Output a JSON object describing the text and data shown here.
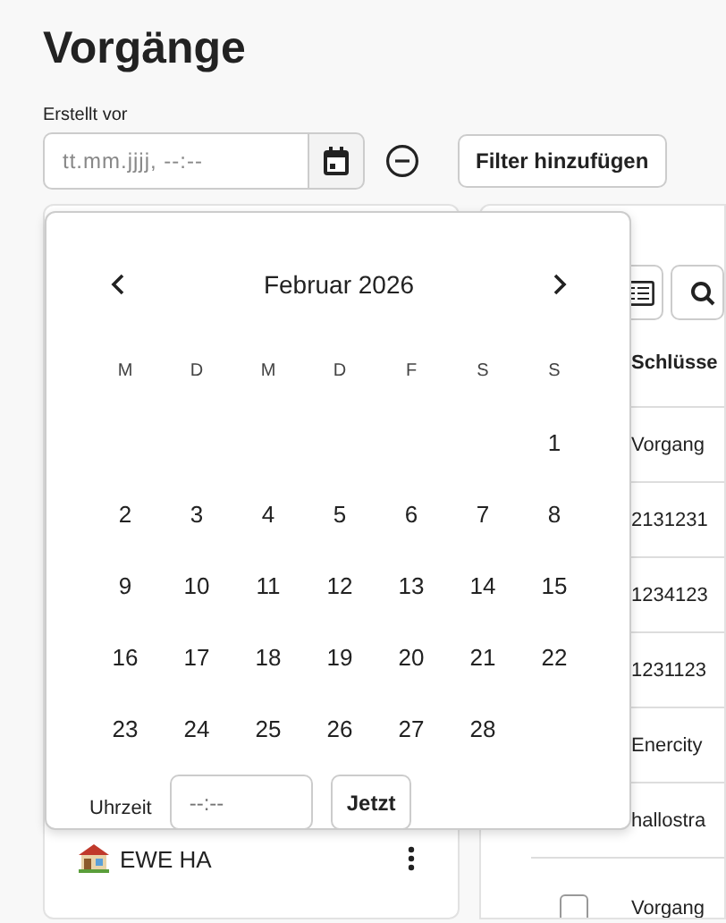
{
  "title": "Vorgänge",
  "filter": {
    "label": "Erstellt vor",
    "placeholder": "tt.mm.jjjj, --:--"
  },
  "add_filter_button": "Filter hinzufügen",
  "date_picker": {
    "month": "Februar 2026",
    "weekdays": [
      "M",
      "D",
      "M",
      "D",
      "F",
      "S",
      "S"
    ],
    "weeks": [
      [
        "1"
      ],
      [
        "2",
        "3",
        "4",
        "5",
        "6",
        "7",
        "8"
      ],
      [
        "9",
        "10",
        "11",
        "12",
        "13",
        "14",
        "15"
      ],
      [
        "16",
        "17",
        "18",
        "19",
        "20",
        "21",
        "22"
      ],
      [
        "23",
        "24",
        "25",
        "26",
        "27",
        "28"
      ]
    ],
    "time_label": "Uhrzeit",
    "time_placeholder": "--:--",
    "now_button": "Jetzt"
  },
  "sidebar": {
    "items": [
      {
        "label": "EWE HA"
      }
    ]
  },
  "table": {
    "column_1": "Schlüsse",
    "rows": [
      {
        "text": "Vorgang"
      },
      {
        "text": "2131231"
      },
      {
        "text": "1234123"
      },
      {
        "text": "1231123"
      },
      {
        "text": "Enercity"
      },
      {
        "text": "hallostra"
      },
      {
        "text": "Vorgang",
        "checked": false
      }
    ]
  }
}
